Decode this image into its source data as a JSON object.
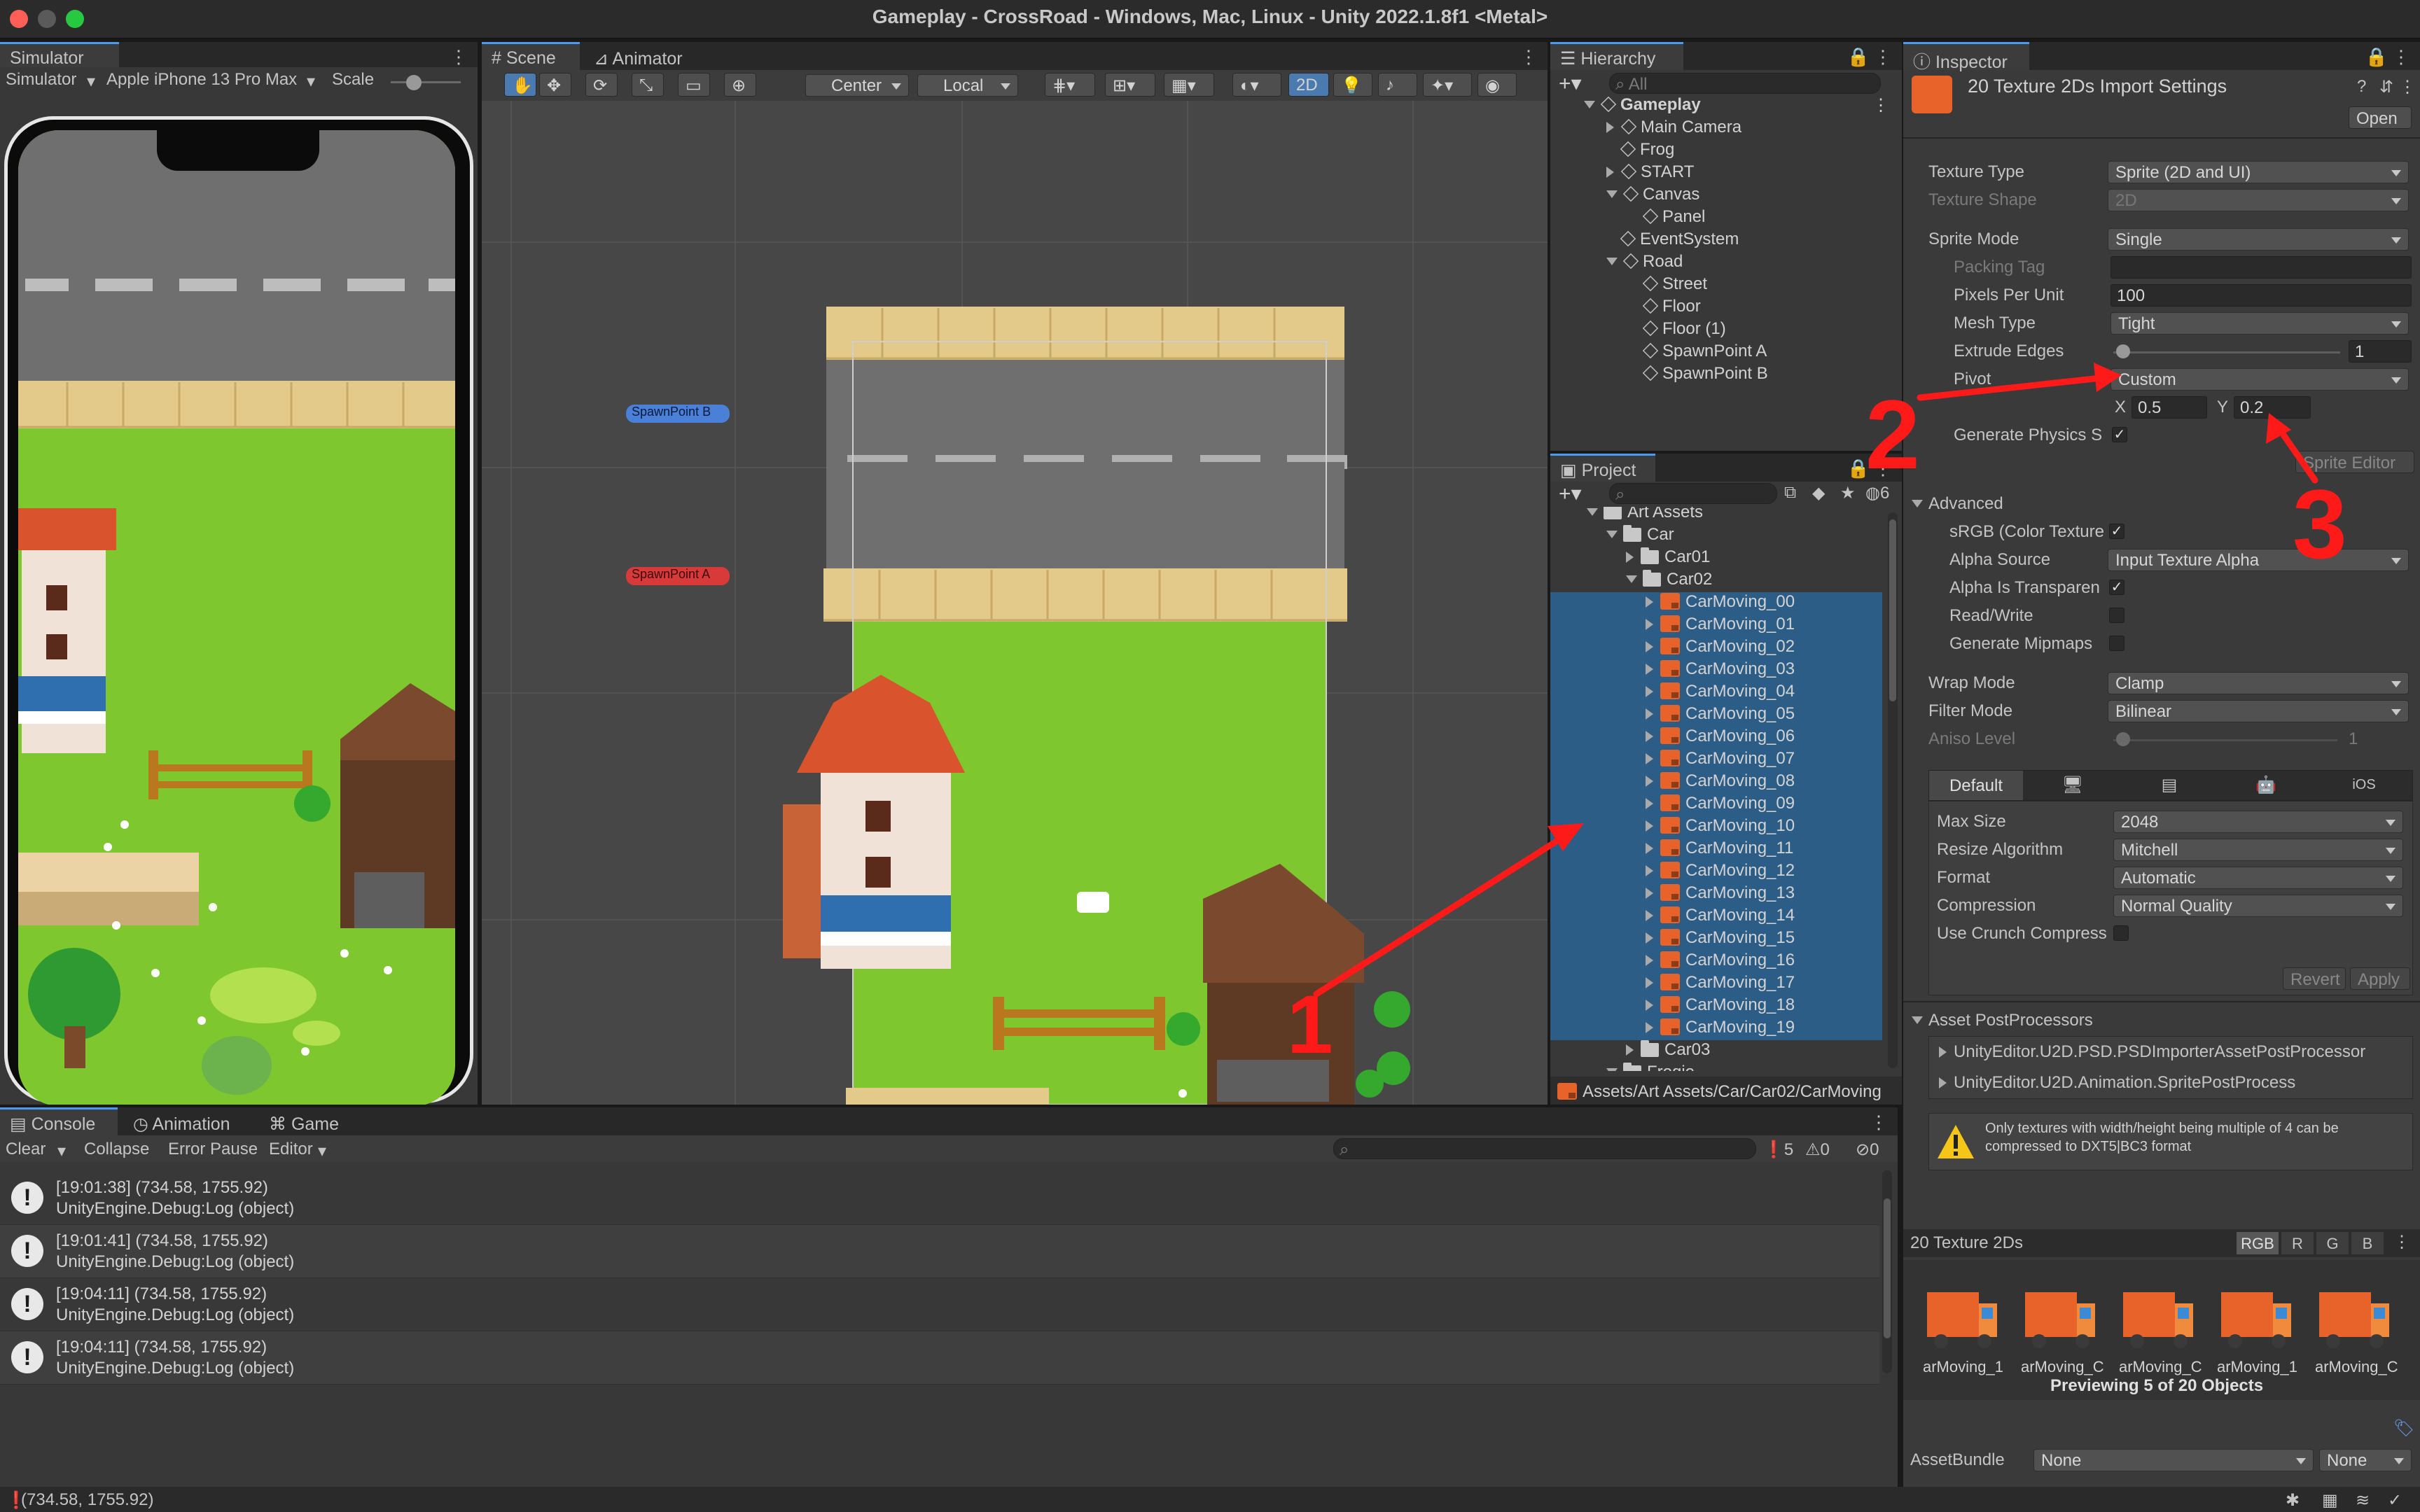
{
  "window": {
    "title": "Gameplay - CrossRoad - Windows, Mac, Linux - Unity 2022.1.8f1 <Metal>"
  },
  "simulator": {
    "tab": "Simulator",
    "mode": "Simulator",
    "device": "Apple iPhone 13 Pro Max",
    "scale_label": "Scale"
  },
  "scene": {
    "tabs": [
      "Scene",
      "Animator"
    ],
    "pivot": "Center",
    "space": "Local",
    "mode_2d": "2D",
    "spawn_b": "SpawnPoint B",
    "spawn_a": "SpawnPoint A"
  },
  "annotations": {
    "n1": "1",
    "n2": "2",
    "n3": "3"
  },
  "hierarchy": {
    "tab": "Hierarchy",
    "search_placeholder": "All",
    "items": [
      {
        "label": "Gameplay",
        "depth": 0
      },
      {
        "label": "Main Camera",
        "depth": 1
      },
      {
        "label": "Frog",
        "depth": 1
      },
      {
        "label": "START",
        "depth": 1
      },
      {
        "label": "Canvas",
        "depth": 1
      },
      {
        "label": "Panel",
        "depth": 2
      },
      {
        "label": "EventSystem",
        "depth": 1
      },
      {
        "label": "Road",
        "depth": 1
      },
      {
        "label": "Street",
        "depth": 2
      },
      {
        "label": "Floor",
        "depth": 2
      },
      {
        "label": "Floor (1)",
        "depth": 2
      },
      {
        "label": "SpawnPoint A",
        "depth": 2
      },
      {
        "label": "SpawnPoint B",
        "depth": 2
      }
    ]
  },
  "project": {
    "tab": "Project",
    "hidden_count": "6",
    "folders": [
      "Art Assets",
      "Car",
      "Car01",
      "Car02"
    ],
    "sprites": [
      "CarMoving_00",
      "CarMoving_01",
      "CarMoving_02",
      "CarMoving_03",
      "CarMoving_04",
      "CarMoving_05",
      "CarMoving_06",
      "CarMoving_07",
      "CarMoving_08",
      "CarMoving_09",
      "CarMoving_10",
      "CarMoving_11",
      "CarMoving_12",
      "CarMoving_13",
      "CarMoving_14",
      "CarMoving_15",
      "CarMoving_16",
      "CarMoving_17",
      "CarMoving_18",
      "CarMoving_19"
    ],
    "after": [
      "Car03",
      "Frogie"
    ],
    "path": "Assets/Art Assets/Car/Car02/CarMoving"
  },
  "console": {
    "tabs": [
      "Console",
      "Animation",
      "Game"
    ],
    "clear": "Clear",
    "collapse": "Collapse",
    "error_pause": "Error Pause",
    "editor": "Editor",
    "count_log": "5",
    "count_warn": "0",
    "count_err": "0",
    "logs": [
      {
        "line1": "[19:01:38] (734.58, 1755.92)",
        "line2": "UnityEngine.Debug:Log (object)"
      },
      {
        "line1": "[19:01:41] (734.58, 1755.92)",
        "line2": "UnityEngine.Debug:Log (object)"
      },
      {
        "line1": "[19:04:11] (734.58, 1755.92)",
        "line2": "UnityEngine.Debug:Log (object)"
      },
      {
        "line1": "[19:04:11] (734.58, 1755.92)",
        "line2": "UnityEngine.Debug:Log (object)"
      }
    ]
  },
  "status": {
    "text": "(734.58, 1755.92)"
  },
  "inspector": {
    "tab": "Inspector",
    "title": "20 Texture 2Ds Import Settings",
    "open": "Open",
    "texture_type_label": "Texture Type",
    "texture_type": "Sprite (2D and UI)",
    "texture_shape_label": "Texture Shape",
    "texture_shape": "2D",
    "sprite_mode_label": "Sprite Mode",
    "sprite_mode": "Single",
    "packing_tag_label": "Packing Tag",
    "ppu_label": "Pixels Per Unit",
    "ppu": "100",
    "mesh_type_label": "Mesh Type",
    "mesh_type": "Tight",
    "extrude_label": "Extrude Edges",
    "extrude": "1",
    "pivot_label": "Pivot",
    "pivot": "Custom",
    "pivot_x_label": "X",
    "pivot_x": "0.5",
    "pivot_y_label": "Y",
    "pivot_y": "0.2",
    "gen_physics_label": "Generate Physics S",
    "sprite_editor": "Sprite Editor",
    "advanced": "Advanced",
    "srgb_label": "sRGB (Color Texture",
    "alpha_source_label": "Alpha Source",
    "alpha_source": "Input Texture Alpha",
    "alpha_transp_label": "Alpha Is Transparen",
    "readwrite_label": "Read/Write",
    "mipmaps_label": "Generate Mipmaps",
    "wrap_label": "Wrap Mode",
    "wrap": "Clamp",
    "filter_label": "Filter Mode",
    "filter": "Bilinear",
    "aniso_label": "Aniso Level",
    "aniso": "1",
    "platform_default": "Default",
    "platform_ios": "iOS",
    "max_size_label": "Max Size",
    "max_size": "2048",
    "resize_label": "Resize Algorithm",
    "resize": "Mitchell",
    "format_label": "Format",
    "format": "Automatic",
    "compression_label": "Compression",
    "compression": "Normal Quality",
    "crunch_label": "Use Crunch Compress",
    "revert": "Revert",
    "apply": "Apply",
    "postprocessors_title": "Asset PostProcessors",
    "postprocessors": [
      "UnityEditor.U2D.PSD.PSDImporterAssetPostProcessor",
      "UnityEditor.U2D.Animation.SpritePostProcess"
    ],
    "warning": "Only textures with width/height being multiple of 4 can be compressed to DXT5|BC3 format",
    "preview_title": "20 Texture 2Ds",
    "channels": [
      "RGB",
      "R",
      "G",
      "B"
    ],
    "thumbs": [
      "arMoving_1",
      "arMoving_C",
      "arMoving_C",
      "arMoving_1",
      "arMoving_C"
    ],
    "previewing": "Previewing 5 of 20 Objects",
    "assetbundle_label": "AssetBundle",
    "assetbundle": "None",
    "variant": "None"
  },
  "colors": {
    "accent": "#4a9cf0",
    "selection": "#2c5d87",
    "annotation": "#ff1a1a"
  }
}
